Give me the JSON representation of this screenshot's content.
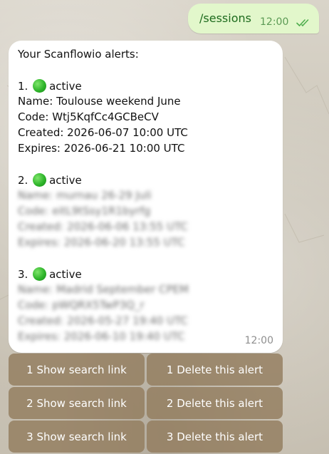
{
  "outgoing": {
    "text": "/sessions",
    "time": "12:00",
    "status_icon": "double-check-icon"
  },
  "incoming": {
    "intro": "Your Scanflowio alerts:",
    "time": "12:00",
    "alerts": [
      {
        "number": "1.",
        "status": "active",
        "status_color": "#2fb52b",
        "name": "Name: Toulouse weekend June",
        "code": "Code: Wtj5KqfCc4GCBeCV",
        "created": "Created: 2026-06-07 10:00 UTC",
        "expires": "Expires: 2026-06-21 10:00 UTC"
      },
      {
        "number": "2.",
        "status": "active",
        "status_color": "#2fb52b",
        "name": "Name: murnau 26-29 Juli",
        "code": "Code: eitL9tSsy1R1byrfg",
        "created": "Created: 2026-06-06 13:55 UTC",
        "expires": "Expires: 2026-06-20 13:55 UTC"
      },
      {
        "number": "3.",
        "status": "active",
        "status_color": "#2fb52b",
        "name": "Name: Madrid September CPEM",
        "code": "Code: pWQRX5TwP3Q_r",
        "created": "Created: 2026-05-27 19:40 UTC",
        "expires": "Expires: 2026-06-10 19:40 UTC"
      }
    ]
  },
  "keyboard": [
    {
      "show": "1 Show search link",
      "delete": "1 Delete this alert"
    },
    {
      "show": "2 Show search link",
      "delete": "2 Delete this alert"
    },
    {
      "show": "3 Show search link",
      "delete": "3 Delete this alert"
    }
  ]
}
